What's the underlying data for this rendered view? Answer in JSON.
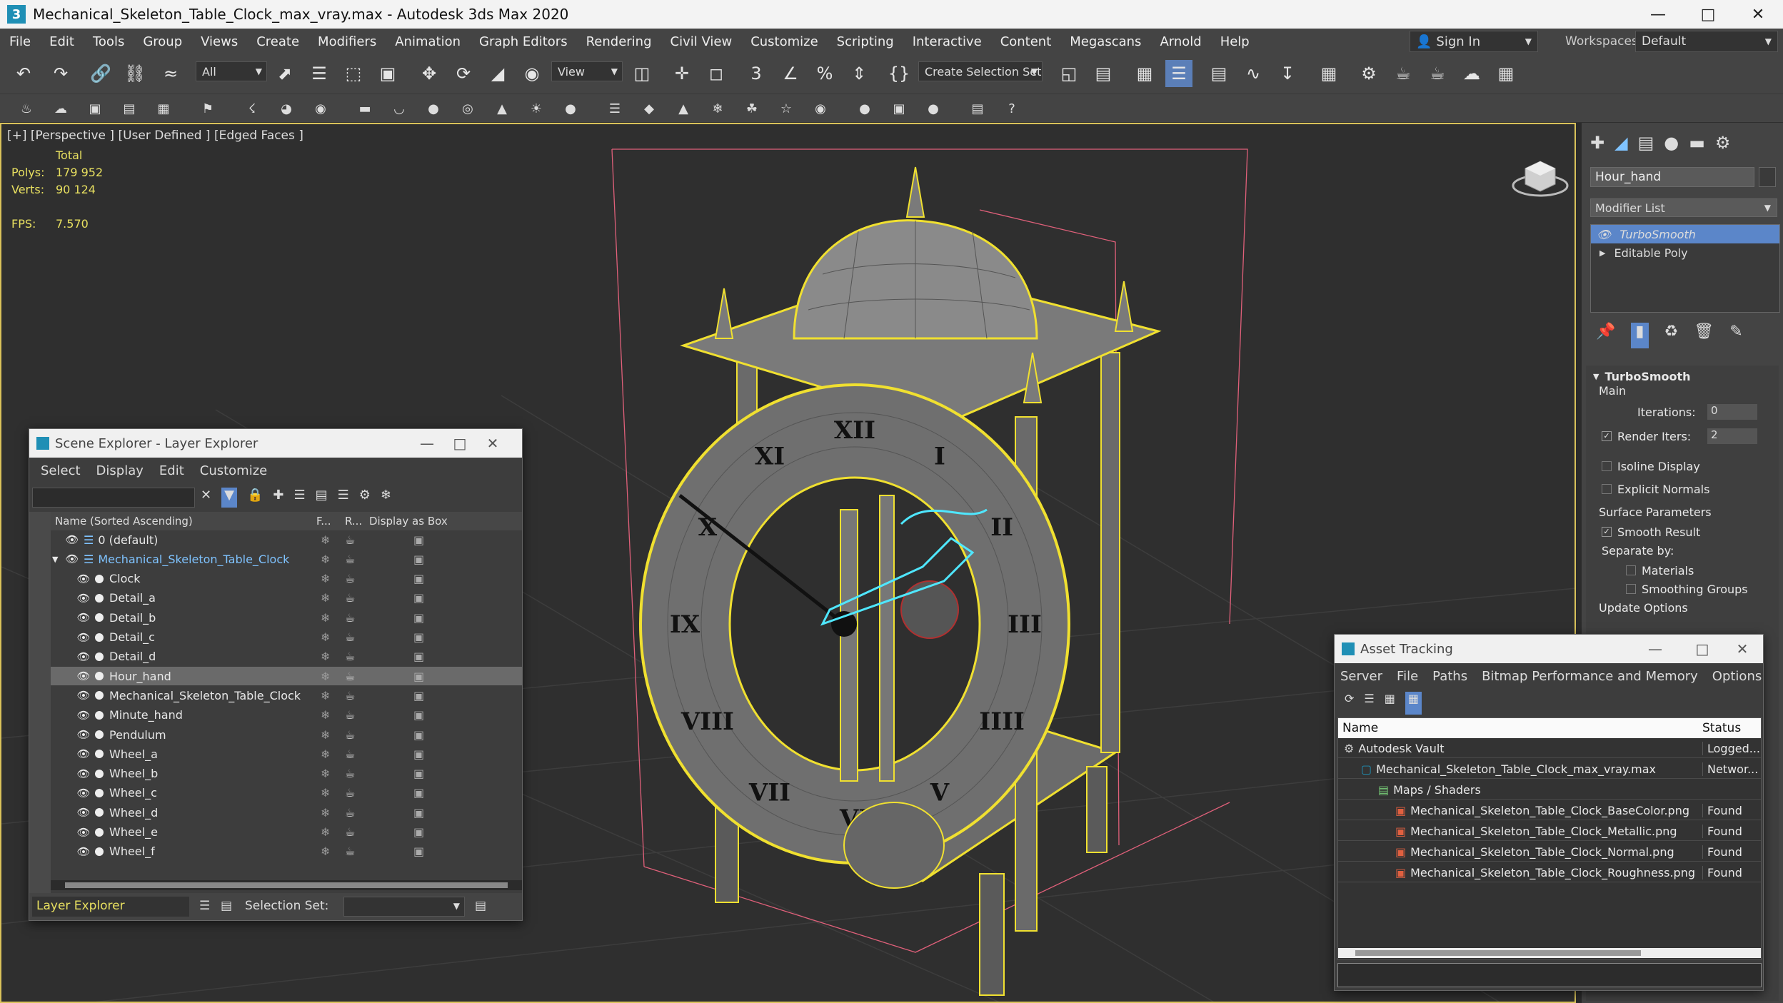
{
  "window": {
    "title": "Mechanical_Skeleton_Table_Clock_max_vray.max - Autodesk 3ds Max 2020",
    "app_icon": "3"
  },
  "menu": [
    "File",
    "Edit",
    "Tools",
    "Group",
    "Views",
    "Create",
    "Modifiers",
    "Animation",
    "Graph Editors",
    "Rendering",
    "Civil View",
    "Customize",
    "Scripting",
    "Interactive",
    "Content",
    "Megascans",
    "Arnold",
    "Help"
  ],
  "account": {
    "sign_in": "Sign In",
    "workspaces_label": "Workspaces:",
    "workspace": "Default"
  },
  "toolbar": {
    "filter": "All",
    "ref_coord": "View",
    "selection_set": "Create Selection Set"
  },
  "viewport": {
    "label": "[+] [Perspective ] [User Defined ] [Edged Faces ]",
    "stats_header": "Total",
    "polys_label": "Polys:",
    "polys": "179 952",
    "verts_label": "Verts:",
    "verts": "90 124",
    "fps_label": "FPS:",
    "fps": "7.570",
    "roman_numerals": [
      "XII",
      "I",
      "II",
      "III",
      "IIII",
      "V",
      "VI",
      "VII",
      "VIII",
      "IX",
      "X",
      "XI"
    ]
  },
  "command_panel": {
    "object_name": "Hour_hand",
    "modifier_list": "Modifier List",
    "stack": [
      "TurboSmooth",
      "Editable Poly"
    ],
    "rollout_title": "TurboSmooth",
    "main_label": "Main",
    "iterations_label": "Iterations:",
    "iterations": "0",
    "render_iters_label": "Render Iters:",
    "render_iters": "2",
    "isoline": "Isoline Display",
    "explicit_normals": "Explicit Normals",
    "surface_params": "Surface Parameters",
    "smooth_result": "Smooth Result",
    "separate_by": "Separate by:",
    "materials": "Materials",
    "smoothing_groups": "Smoothing Groups",
    "update_options": "Update Options"
  },
  "scene_explorer": {
    "title": "Scene Explorer - Layer Explorer",
    "menu": [
      "Select",
      "Display",
      "Edit",
      "Customize"
    ],
    "columns": {
      "name": "Name (Sorted Ascending)",
      "f": "F...",
      "r": "R...",
      "box": "Display as Box"
    },
    "rows": [
      {
        "name": "0 (default)",
        "level": 0
      },
      {
        "name": "Mechanical_Skeleton_Table_Clock",
        "level": 0
      },
      {
        "name": "Clock",
        "level": 1
      },
      {
        "name": "Detail_a",
        "level": 1
      },
      {
        "name": "Detail_b",
        "level": 1
      },
      {
        "name": "Detail_c",
        "level": 1
      },
      {
        "name": "Detail_d",
        "level": 1
      },
      {
        "name": "Hour_hand",
        "level": 1
      },
      {
        "name": "Mechanical_Skeleton_Table_Clock",
        "level": 1
      },
      {
        "name": "Minute_hand",
        "level": 1
      },
      {
        "name": "Pendulum",
        "level": 1
      },
      {
        "name": "Wheel_a",
        "level": 1
      },
      {
        "name": "Wheel_b",
        "level": 1
      },
      {
        "name": "Wheel_c",
        "level": 1
      },
      {
        "name": "Wheel_d",
        "level": 1
      },
      {
        "name": "Wheel_e",
        "level": 1
      },
      {
        "name": "Wheel_f",
        "level": 1
      }
    ],
    "footer_mode": "Layer Explorer",
    "selection_set_label": "Selection Set:"
  },
  "asset_tracking": {
    "title": "Asset Tracking",
    "menu": [
      "Server",
      "File",
      "Paths",
      "Bitmap Performance and Memory",
      "Options"
    ],
    "columns": {
      "name": "Name",
      "status": "Status"
    },
    "rows": [
      {
        "name": "Autodesk Vault",
        "status": "Logged...",
        "level": 0
      },
      {
        "name": "Mechanical_Skeleton_Table_Clock_max_vray.max",
        "status": "Networ...",
        "level": 1
      },
      {
        "name": "Maps / Shaders",
        "status": "",
        "level": 2
      },
      {
        "name": "Mechanical_Skeleton_Table_Clock_BaseColor.png",
        "status": "Found",
        "level": 3
      },
      {
        "name": "Mechanical_Skeleton_Table_Clock_Metallic.png",
        "status": "Found",
        "level": 3
      },
      {
        "name": "Mechanical_Skeleton_Table_Clock_Normal.png",
        "status": "Found",
        "level": 3
      },
      {
        "name": "Mechanical_Skeleton_Table_Clock_Roughness.png",
        "status": "Found",
        "level": 3
      }
    ]
  }
}
